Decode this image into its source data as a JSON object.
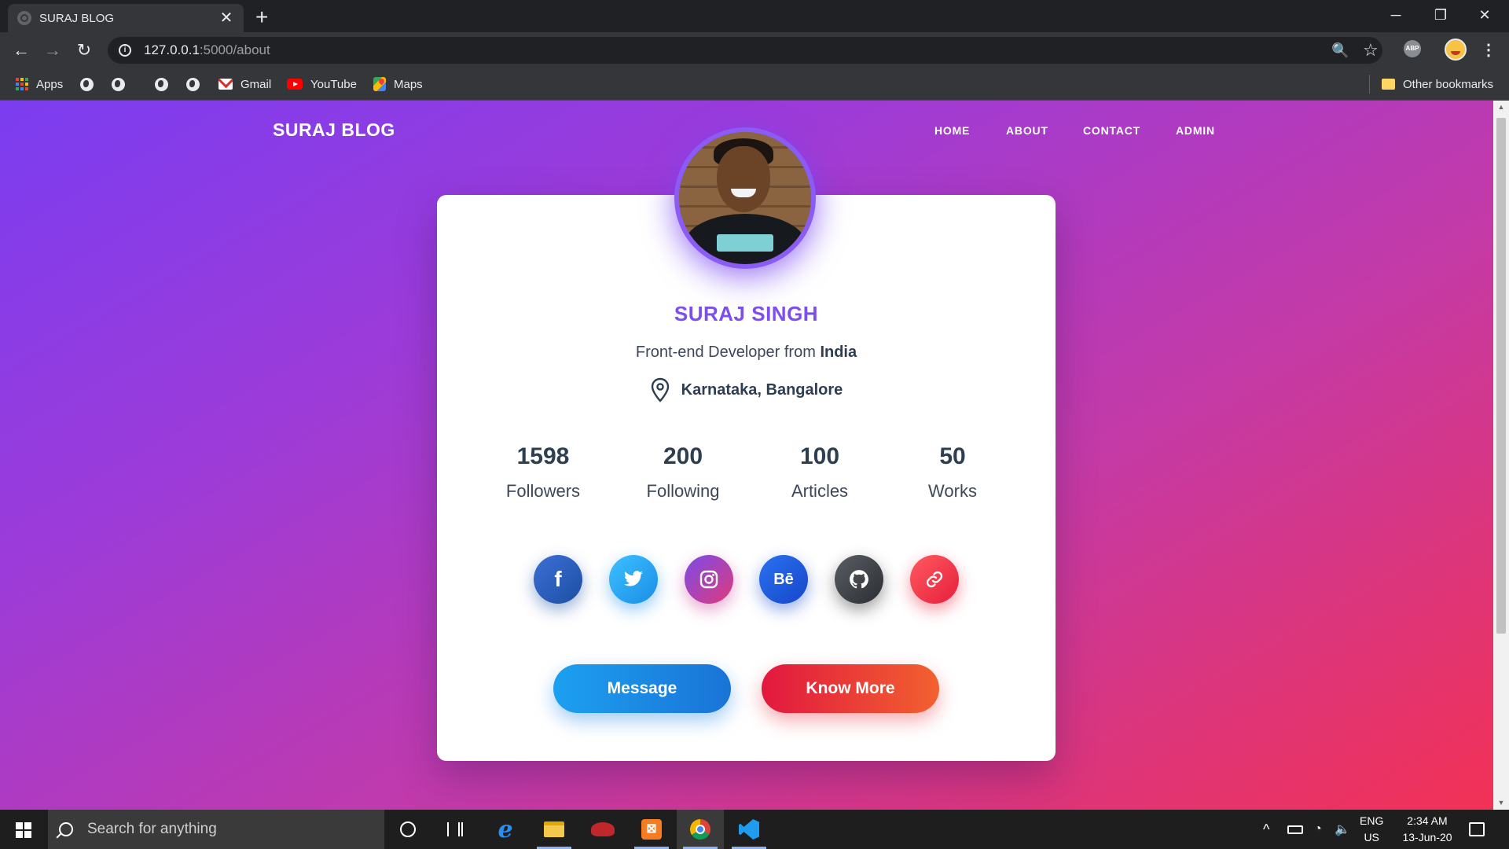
{
  "browser": {
    "tab": {
      "title": "SURAJ BLOG",
      "close": "✕",
      "favicon": "globe-icon"
    },
    "new_tab": "+",
    "window_controls": {
      "minimize": "─",
      "restore": "❐",
      "close": "✕"
    },
    "nav": {
      "back": "←",
      "forward": "→",
      "reload": "↻"
    },
    "url": {
      "host": "127.0.0.1",
      "path": ":5000/about"
    },
    "toolbar_icons": {
      "zoom": "🔍",
      "star": "☆",
      "abp": "ABP",
      "menu": "⋮"
    },
    "bookmarks": [
      {
        "label": "Apps",
        "icon": "apps-grid-icon"
      },
      {
        "label": "",
        "icon": "globe-icon"
      },
      {
        "label": "",
        "icon": "globe-icon"
      },
      {
        "label": "",
        "icon": "globe-icon"
      },
      {
        "label": "",
        "icon": "globe-icon"
      },
      {
        "label": "Gmail",
        "icon": "gmail-icon"
      },
      {
        "label": "YouTube",
        "icon": "youtube-icon"
      },
      {
        "label": "Maps",
        "icon": "maps-icon"
      }
    ],
    "other_bookmarks": "Other bookmarks"
  },
  "site": {
    "brand": "SURAJ BLOG",
    "nav": [
      "HOME",
      "ABOUT",
      "CONTACT",
      "ADMIN"
    ]
  },
  "profile": {
    "name": "SURAJ SINGH",
    "role_prefix": "Front-end Developer from",
    "role_country": "India",
    "location": "Karnataka, Bangalore",
    "stats": [
      {
        "value": "1598",
        "label": "Followers"
      },
      {
        "value": "200",
        "label": "Following"
      },
      {
        "value": "100",
        "label": "Articles"
      },
      {
        "value": "50",
        "label": "Works"
      }
    ],
    "social": [
      {
        "name": "facebook",
        "glyph": "f"
      },
      {
        "name": "twitter",
        "glyph": "🐦"
      },
      {
        "name": "instagram",
        "glyph": "◎"
      },
      {
        "name": "behance",
        "glyph": "Bē"
      },
      {
        "name": "github",
        "glyph": "◉"
      },
      {
        "name": "link",
        "glyph": "🔗"
      }
    ],
    "buttons": {
      "message": "Message",
      "know_more": "Know More"
    }
  },
  "colors": {
    "accent": "#7c4df0",
    "gradient_start": "#7b3df0",
    "gradient_end": "#f23155",
    "message_button": "#1a8ee6",
    "know_more_button": "#e2183f"
  },
  "taskbar": {
    "search_placeholder": "Search for anything",
    "language": "ENG",
    "region": "US",
    "time": "2:34 AM",
    "date": "13-Jun-20",
    "tray_up": "^"
  }
}
